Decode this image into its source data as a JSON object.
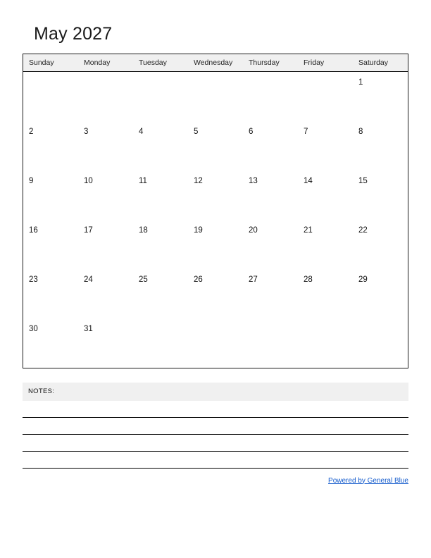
{
  "calendar": {
    "title": "May 2027",
    "weekday_headers": [
      "Sunday",
      "Monday",
      "Tuesday",
      "Wednesday",
      "Thursday",
      "Friday",
      "Saturday"
    ],
    "weeks": [
      [
        "",
        "",
        "",
        "",
        "",
        "",
        "1"
      ],
      [
        "2",
        "3",
        "4",
        "5",
        "6",
        "7",
        "8"
      ],
      [
        "9",
        "10",
        "11",
        "12",
        "13",
        "14",
        "15"
      ],
      [
        "16",
        "17",
        "18",
        "19",
        "20",
        "21",
        "22"
      ],
      [
        "23",
        "24",
        "25",
        "26",
        "27",
        "28",
        "29"
      ],
      [
        "30",
        "31",
        "",
        "",
        "",
        "",
        ""
      ]
    ]
  },
  "notes": {
    "label": "NOTES:",
    "line_count": 4
  },
  "footer": {
    "link_text": "Powered by General Blue"
  },
  "colors": {
    "header_background": "#f0f0f0",
    "grid_border": "#1b1b1b",
    "link": "#1159cc",
    "text": "#111111",
    "page_background": "#ffffff"
  }
}
